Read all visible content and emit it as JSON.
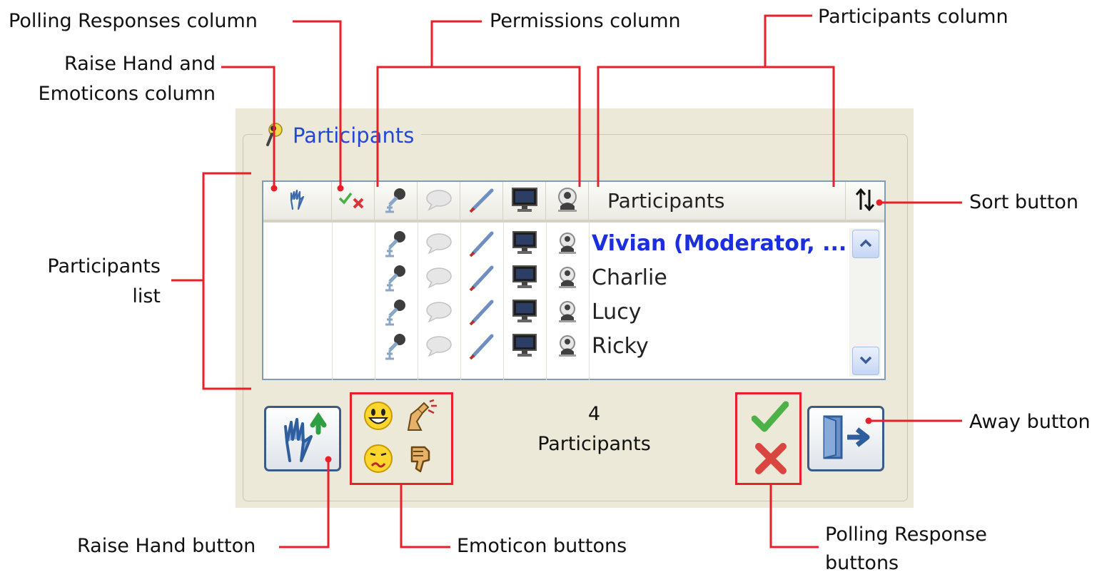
{
  "callouts": {
    "polling_responses_column": "Polling Responses column",
    "raise_hand_emoticons_column_1": "Raise Hand and",
    "raise_hand_emoticons_column_2": "Emoticons column",
    "permissions_column": "Permissions column",
    "participants_column": "Participants column",
    "participants_list_1": "Participants",
    "participants_list_2": "list",
    "sort_button": "Sort button",
    "away_button": "Away button",
    "raise_hand_button": "Raise Hand button",
    "emoticon_buttons": "Emoticon buttons",
    "polling_response_buttons_1": "Polling Response",
    "polling_response_buttons_2": "buttons"
  },
  "panel": {
    "title": "Participants",
    "title_icon": "microphone-person-icon",
    "header": {
      "participants_label": "Participants",
      "icons": [
        "raise-hand-icon",
        "polling-check-x-icon",
        "microphone-icon",
        "chat-bubble-icon",
        "pen-icon",
        "monitor-icon",
        "webcam-icon"
      ],
      "sort_icon": "sort-arrows-icon"
    },
    "participants": [
      {
        "name": "Vivian (Moderator, ...",
        "moderator": true
      },
      {
        "name": "Charlie",
        "moderator": false
      },
      {
        "name": "Lucy",
        "moderator": false
      },
      {
        "name": "Ricky",
        "moderator": false
      }
    ],
    "count_number": "4",
    "count_label": "Participants",
    "emoticons": [
      "smile-icon",
      "applause-icon",
      "confused-icon",
      "thumbs-down-icon"
    ],
    "colors": {
      "accent_blue": "#2447d6",
      "callout_red": "#e8202a",
      "panel_bg": "#ece9d8"
    }
  }
}
